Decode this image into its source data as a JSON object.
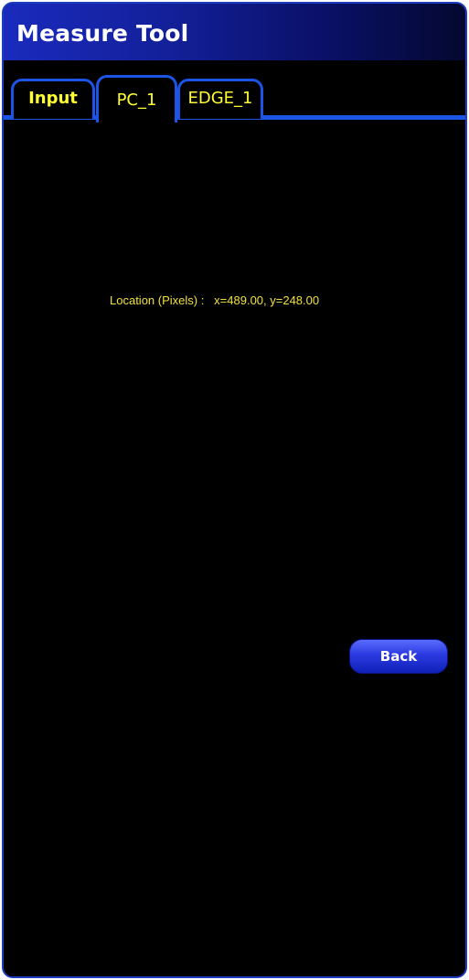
{
  "window": {
    "title": "Measure Tool"
  },
  "tabs": [
    {
      "label": "Input",
      "active": false
    },
    {
      "label": "PC_1",
      "active": true
    },
    {
      "label": "EDGE_1",
      "active": false
    }
  ],
  "content": {
    "location_label": "Location (Pixels) :",
    "location_value": "x=489.00, y=248.00"
  },
  "buttons": {
    "back_label": "Back"
  },
  "colors": {
    "background": "#000000",
    "title_bar": "#1a2bbd",
    "tab_border": "#1c55e6",
    "tab_text": "#ffff33",
    "location_text": "#f0e040",
    "button": "#2a3ae0"
  }
}
